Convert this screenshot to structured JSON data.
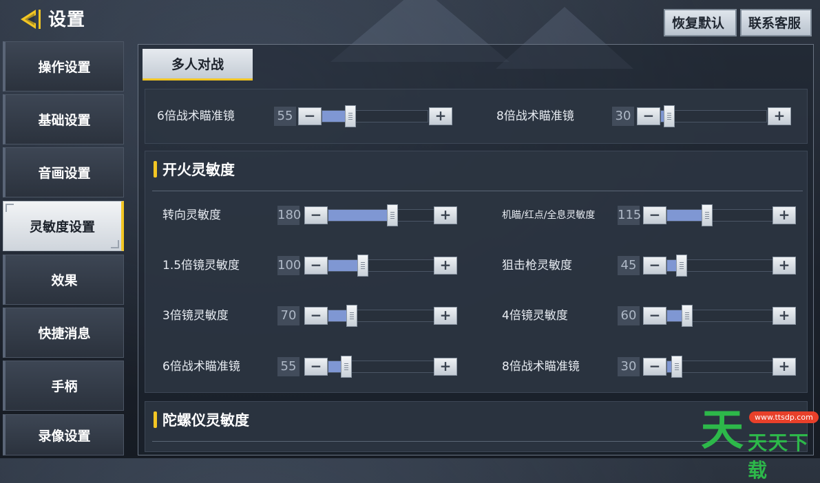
{
  "header": {
    "title": "设置",
    "back_icon": "back-arrow-icon",
    "reset_label": "恢复默认",
    "contact_label": "联系客服"
  },
  "colors": {
    "accent": "#f3c623",
    "slider_fill": "#7f97d3",
    "watermark_green": "#2db84a"
  },
  "sidebar": {
    "items": [
      {
        "label": "操作设置",
        "active": false
      },
      {
        "label": "基础设置",
        "active": false
      },
      {
        "label": "音画设置",
        "active": false
      },
      {
        "label": "灵敏度设置",
        "active": true
      },
      {
        "label": "效果",
        "active": false
      },
      {
        "label": "快捷消息",
        "active": false
      },
      {
        "label": "手柄",
        "active": false
      },
      {
        "label": "录像设置",
        "active": false
      }
    ]
  },
  "main": {
    "mode_tab": "多人对战",
    "top_row": [
      {
        "label": "6倍战术瞄准镜",
        "value": "55",
        "fraction": 0.27
      },
      {
        "label": "8倍战术瞄准镜",
        "value": "30",
        "fraction": 0.08
      }
    ],
    "fire_section": {
      "title": "开火灵敏度",
      "rows": [
        {
          "label": "转向灵敏度",
          "value": "180",
          "fraction": 0.61
        },
        {
          "label": "机瞄/红点/全息灵敏度",
          "value": "115",
          "fraction": 0.38
        },
        {
          "label": "1.5倍镜灵敏度",
          "value": "100",
          "fraction": 0.33
        },
        {
          "label": "狙击枪灵敏度",
          "value": "45",
          "fraction": 0.14
        },
        {
          "label": "3倍镜灵敏度",
          "value": "70",
          "fraction": 0.22
        },
        {
          "label": "4倍镜灵敏度",
          "value": "60",
          "fraction": 0.19
        },
        {
          "label": "6倍战术瞄准镜",
          "value": "55",
          "fraction": 0.17
        },
        {
          "label": "8倍战术瞄准镜",
          "value": "30",
          "fraction": 0.09
        }
      ]
    },
    "gyro_section": {
      "title": "陀螺仪灵敏度"
    },
    "minus_label": "−",
    "plus_label": "+"
  },
  "watermark": {
    "big_char": "天",
    "pill_text": "www.ttsdp.com",
    "brand_text": "天天下载"
  }
}
